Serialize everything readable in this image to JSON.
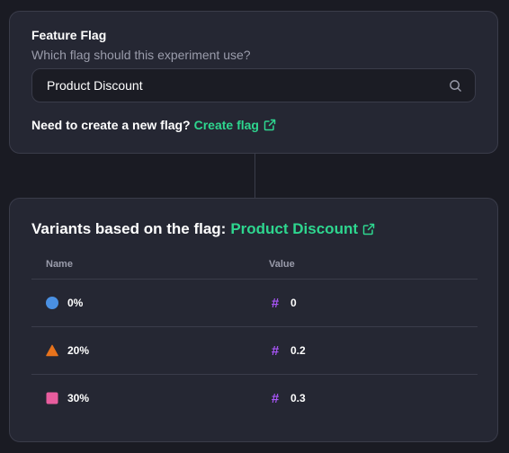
{
  "feature_flag": {
    "label": "Feature Flag",
    "help": "Which flag should this experiment use?",
    "search_value": "Product Discount",
    "create_prompt": "Need to create a new flag?",
    "create_link": "Create flag"
  },
  "variants": {
    "title_prefix": "Variants based on the flag:",
    "flag_name": "Product Discount",
    "columns": {
      "name": "Name",
      "value": "Value"
    },
    "rows": [
      {
        "name": "0%",
        "value": "0",
        "shape": "circle",
        "color": "#4a90e2"
      },
      {
        "name": "20%",
        "value": "0.2",
        "shape": "triangle",
        "color": "#e8731c"
      },
      {
        "name": "30%",
        "value": "0.3",
        "shape": "square",
        "color": "#e85d9e"
      }
    ],
    "value_icon": "#"
  },
  "colors": {
    "accent": "#2ed68f",
    "hash": "#a855f7"
  }
}
